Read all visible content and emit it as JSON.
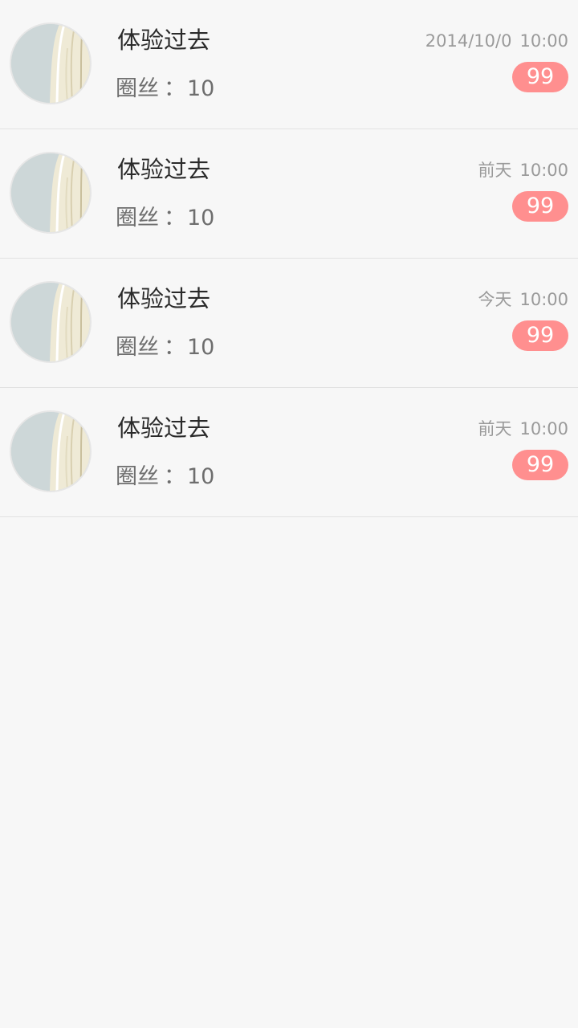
{
  "items": [
    {
      "title": "体验过去",
      "sub_label": "圈丝",
      "sub_colon": "：",
      "sub_value": "10",
      "date": "2014/10/0",
      "time": "10:00",
      "badge": "99"
    },
    {
      "title": "体验过去",
      "sub_label": "圈丝",
      "sub_colon": "：",
      "sub_value": "10",
      "date": "前天",
      "time": "10:00",
      "badge": "99"
    },
    {
      "title": "体验过去",
      "sub_label": "圈丝",
      "sub_colon": "：",
      "sub_value": "10",
      "date": "今天",
      "time": "10:00",
      "badge": "99"
    },
    {
      "title": "体验过去",
      "sub_label": "圈丝",
      "sub_colon": "：",
      "sub_value": "10",
      "date": "前天",
      "time": "10:00",
      "badge": "99"
    }
  ],
  "colors": {
    "background": "#f7f7f7",
    "badge": "#ff8f8f",
    "divider": "#e2e2e2",
    "title_text": "#2a2a2a",
    "meta_text": "#9a9a9a"
  },
  "icons": {
    "avatar": "avatar-image"
  }
}
